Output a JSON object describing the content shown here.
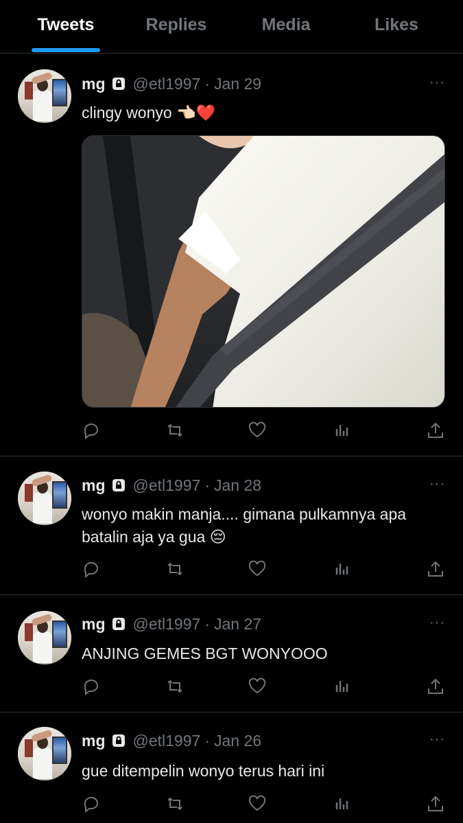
{
  "tabs": [
    {
      "label": "Tweets",
      "active": true
    },
    {
      "label": "Replies",
      "active": false
    },
    {
      "label": "Media",
      "active": false
    },
    {
      "label": "Likes",
      "active": false
    }
  ],
  "colors": {
    "accent": "#1d9bf0",
    "background": "#000000",
    "muted": "#71767b",
    "heart": "#e0245e"
  },
  "icons": [
    "lock-icon",
    "more-icon",
    "reply-icon",
    "retweet-icon",
    "like-icon",
    "views-icon",
    "share-icon"
  ],
  "tweets": [
    {
      "name": "mg",
      "handle": "@etl1997",
      "date": "Jan 29",
      "separator": "·",
      "more": "···",
      "text": "clingy wonyo 👈🏻❤️",
      "has_media": true
    },
    {
      "name": "mg",
      "handle": "@etl1997",
      "date": "Jan 28",
      "separator": "·",
      "more": "···",
      "text": "wonyo makin manja.... gimana pulkamnya apa batalin aja ya gua 😔",
      "has_media": false
    },
    {
      "name": "mg",
      "handle": "@etl1997",
      "date": "Jan 27",
      "separator": "·",
      "more": "···",
      "text": "ANJING GEMES BGT WONYOOO",
      "has_media": false
    },
    {
      "name": "mg",
      "handle": "@etl1997",
      "date": "Jan 26",
      "separator": "·",
      "more": "···",
      "text": "gue ditempelin wonyo terus hari ini",
      "has_media": false
    }
  ]
}
